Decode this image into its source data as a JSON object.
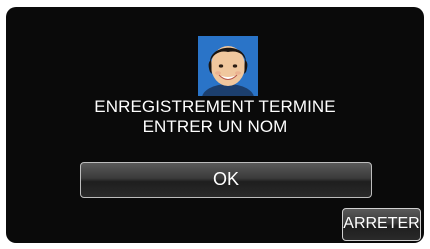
{
  "dialog": {
    "message_line1": "ENREGISTREMENT TERMINE",
    "message_line2": "ENTRER UN NOM",
    "ok_label": "OK",
    "stop_label": "ARRETER"
  },
  "icons": {
    "face_photo": "registered-face-thumbnail"
  },
  "colors": {
    "background": "#0a0a0a",
    "text": "#ffffff",
    "button_border": "#bdbdbd",
    "photo_bg": "#2f7fd0"
  }
}
